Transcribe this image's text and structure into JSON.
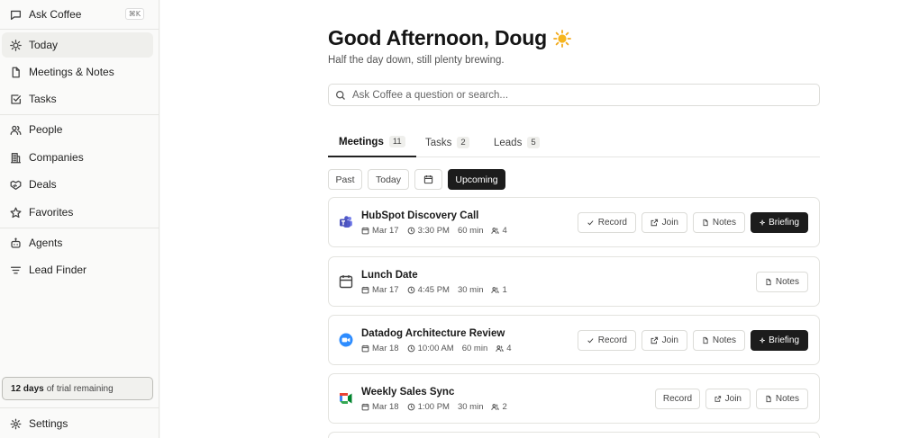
{
  "sidebar": {
    "ask": {
      "label": "Ask Coffee",
      "shortcut": "⌘K"
    },
    "items": [
      {
        "label": "Today"
      },
      {
        "label": "Meetings & Notes"
      },
      {
        "label": "Tasks"
      },
      {
        "label": "People"
      },
      {
        "label": "Companies"
      },
      {
        "label": "Deals"
      },
      {
        "label": "Favorites"
      },
      {
        "label": "Agents"
      },
      {
        "label": "Lead Finder"
      }
    ],
    "trial": {
      "days": "12 days",
      "rest": "of trial remaining"
    },
    "settings": "Settings"
  },
  "main": {
    "greeting": "Good Afternoon, Doug",
    "subtitle": "Half the day down, still plenty brewing.",
    "search_placeholder": "Ask Coffee a question or search...",
    "tabs": [
      {
        "label": "Meetings",
        "count": "11"
      },
      {
        "label": "Tasks",
        "count": "2"
      },
      {
        "label": "Leads",
        "count": "5"
      }
    ],
    "filters": {
      "past": "Past",
      "today": "Today",
      "upcoming": "Upcoming"
    },
    "actions": {
      "record": "Record",
      "join": "Join",
      "notes": "Notes",
      "briefing": "Briefing"
    },
    "meetings": [
      {
        "title": "HubSpot Discovery Call",
        "date": "Mar 17",
        "time": "3:30 PM",
        "duration": "60 min",
        "attendees": "4"
      },
      {
        "title": "Lunch Date",
        "date": "Mar 17",
        "time": "4:45 PM",
        "duration": "30 min",
        "attendees": "1"
      },
      {
        "title": "Datadog Architecture Review",
        "date": "Mar 18",
        "time": "10:00 AM",
        "duration": "60 min",
        "attendees": "4"
      },
      {
        "title": "Weekly Sales Sync",
        "date": "Mar 18",
        "time": "1:00 PM",
        "duration": "30 min",
        "attendees": "2"
      }
    ]
  },
  "colors": {
    "accent_dark": "#1c1c1c",
    "sidebar_bg": "#fafaf9",
    "active_bg": "#efefec"
  }
}
